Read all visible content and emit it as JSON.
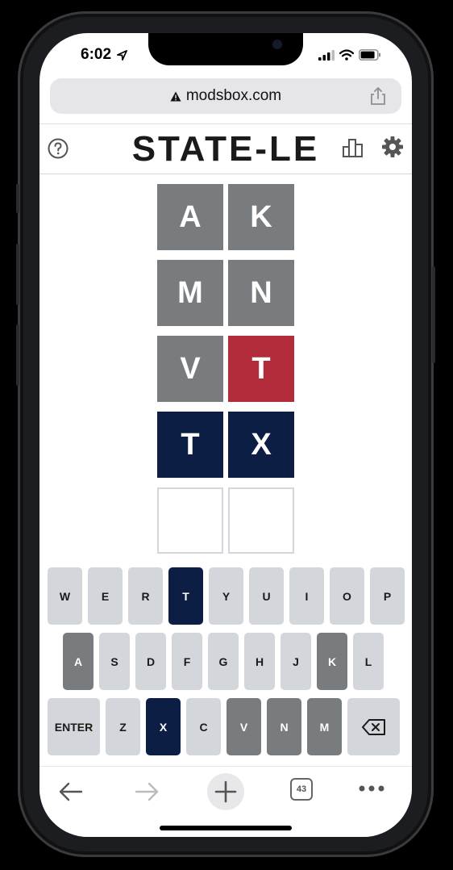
{
  "status": {
    "time": "6:02"
  },
  "browser": {
    "url": "modsbox.com",
    "tabs_count": "43"
  },
  "game": {
    "title": "STATE-LE"
  },
  "colors": {
    "absent": "#787c7e",
    "present": "#b22b3b",
    "correct": "#0d1e45"
  },
  "board": {
    "rows": [
      [
        {
          "letter": "A",
          "state": "absent"
        },
        {
          "letter": "K",
          "state": "absent"
        }
      ],
      [
        {
          "letter": "M",
          "state": "absent"
        },
        {
          "letter": "N",
          "state": "absent"
        }
      ],
      [
        {
          "letter": "V",
          "state": "absent"
        },
        {
          "letter": "T",
          "state": "present"
        }
      ],
      [
        {
          "letter": "T",
          "state": "correct"
        },
        {
          "letter": "X",
          "state": "correct"
        }
      ],
      [
        {
          "letter": "",
          "state": "empty"
        },
        {
          "letter": "",
          "state": "empty"
        }
      ]
    ]
  },
  "keyboard": {
    "row1": [
      {
        "label": "W",
        "state": "default"
      },
      {
        "label": "E",
        "state": "default"
      },
      {
        "label": "R",
        "state": "default"
      },
      {
        "label": "T",
        "state": "correct"
      },
      {
        "label": "Y",
        "state": "default"
      },
      {
        "label": "U",
        "state": "default"
      },
      {
        "label": "I",
        "state": "default"
      },
      {
        "label": "O",
        "state": "default"
      },
      {
        "label": "P",
        "state": "default"
      }
    ],
    "row2": [
      {
        "label": "A",
        "state": "absent"
      },
      {
        "label": "S",
        "state": "default"
      },
      {
        "label": "D",
        "state": "default"
      },
      {
        "label": "F",
        "state": "default"
      },
      {
        "label": "G",
        "state": "default"
      },
      {
        "label": "H",
        "state": "default"
      },
      {
        "label": "J",
        "state": "default"
      },
      {
        "label": "K",
        "state": "absent"
      },
      {
        "label": "L",
        "state": "default"
      }
    ],
    "row3": [
      {
        "label": "ENTER",
        "state": "default"
      },
      {
        "label": "Z",
        "state": "default"
      },
      {
        "label": "X",
        "state": "correct"
      },
      {
        "label": "C",
        "state": "default"
      },
      {
        "label": "V",
        "state": "absent"
      },
      {
        "label": "N",
        "state": "absent"
      },
      {
        "label": "M",
        "state": "absent"
      },
      {
        "label": "",
        "icon": "backspace-icon",
        "state": "default"
      }
    ]
  }
}
